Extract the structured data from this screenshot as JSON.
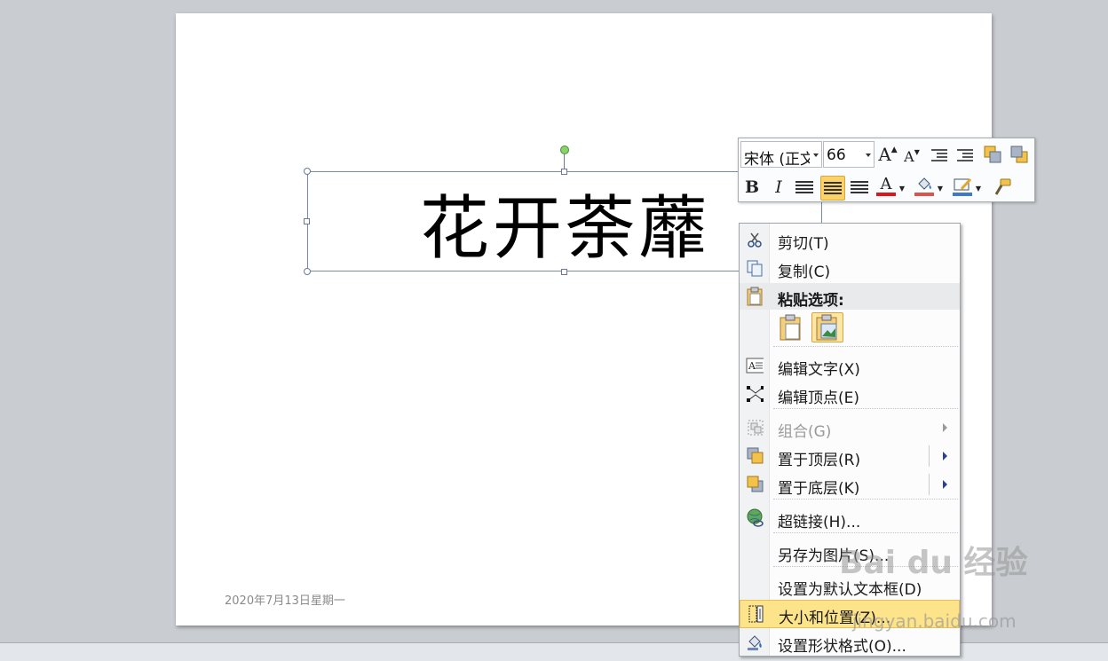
{
  "slide": {
    "title": "花开荼蘼",
    "footer_date": "2020年7月13日星期一"
  },
  "minitoolbar": {
    "font_name": "宋体 (正文",
    "font_size": "66",
    "bold": "B",
    "italic": "I",
    "grow_font": "A",
    "shrink_font": "A",
    "font_color_letter": "A",
    "active_alignment": "center"
  },
  "context_menu": {
    "cut": "剪切(T)",
    "copy": "复制(C)",
    "paste_options": "粘贴选项:",
    "edit_text": "编辑文字(X)",
    "edit_points": "编辑顶点(E)",
    "group": "组合(G)",
    "bring_to_front": "置于顶层(R)",
    "send_to_back": "置于底层(K)",
    "hyperlink": "超链接(H)...",
    "save_as_picture": "另存为图片(S)...",
    "set_default_textbox": "设置为默认文本框(D)",
    "size_position": "大小和位置(Z)...",
    "format_shape": "设置形状格式(O)..."
  },
  "watermark": {
    "brand": "Bai du 经验",
    "url": "jingyan.baidu.com"
  },
  "colors": {
    "font_color": "#e0141b",
    "highlight": "#fbd26a",
    "selection_border": "#6b7a92"
  }
}
